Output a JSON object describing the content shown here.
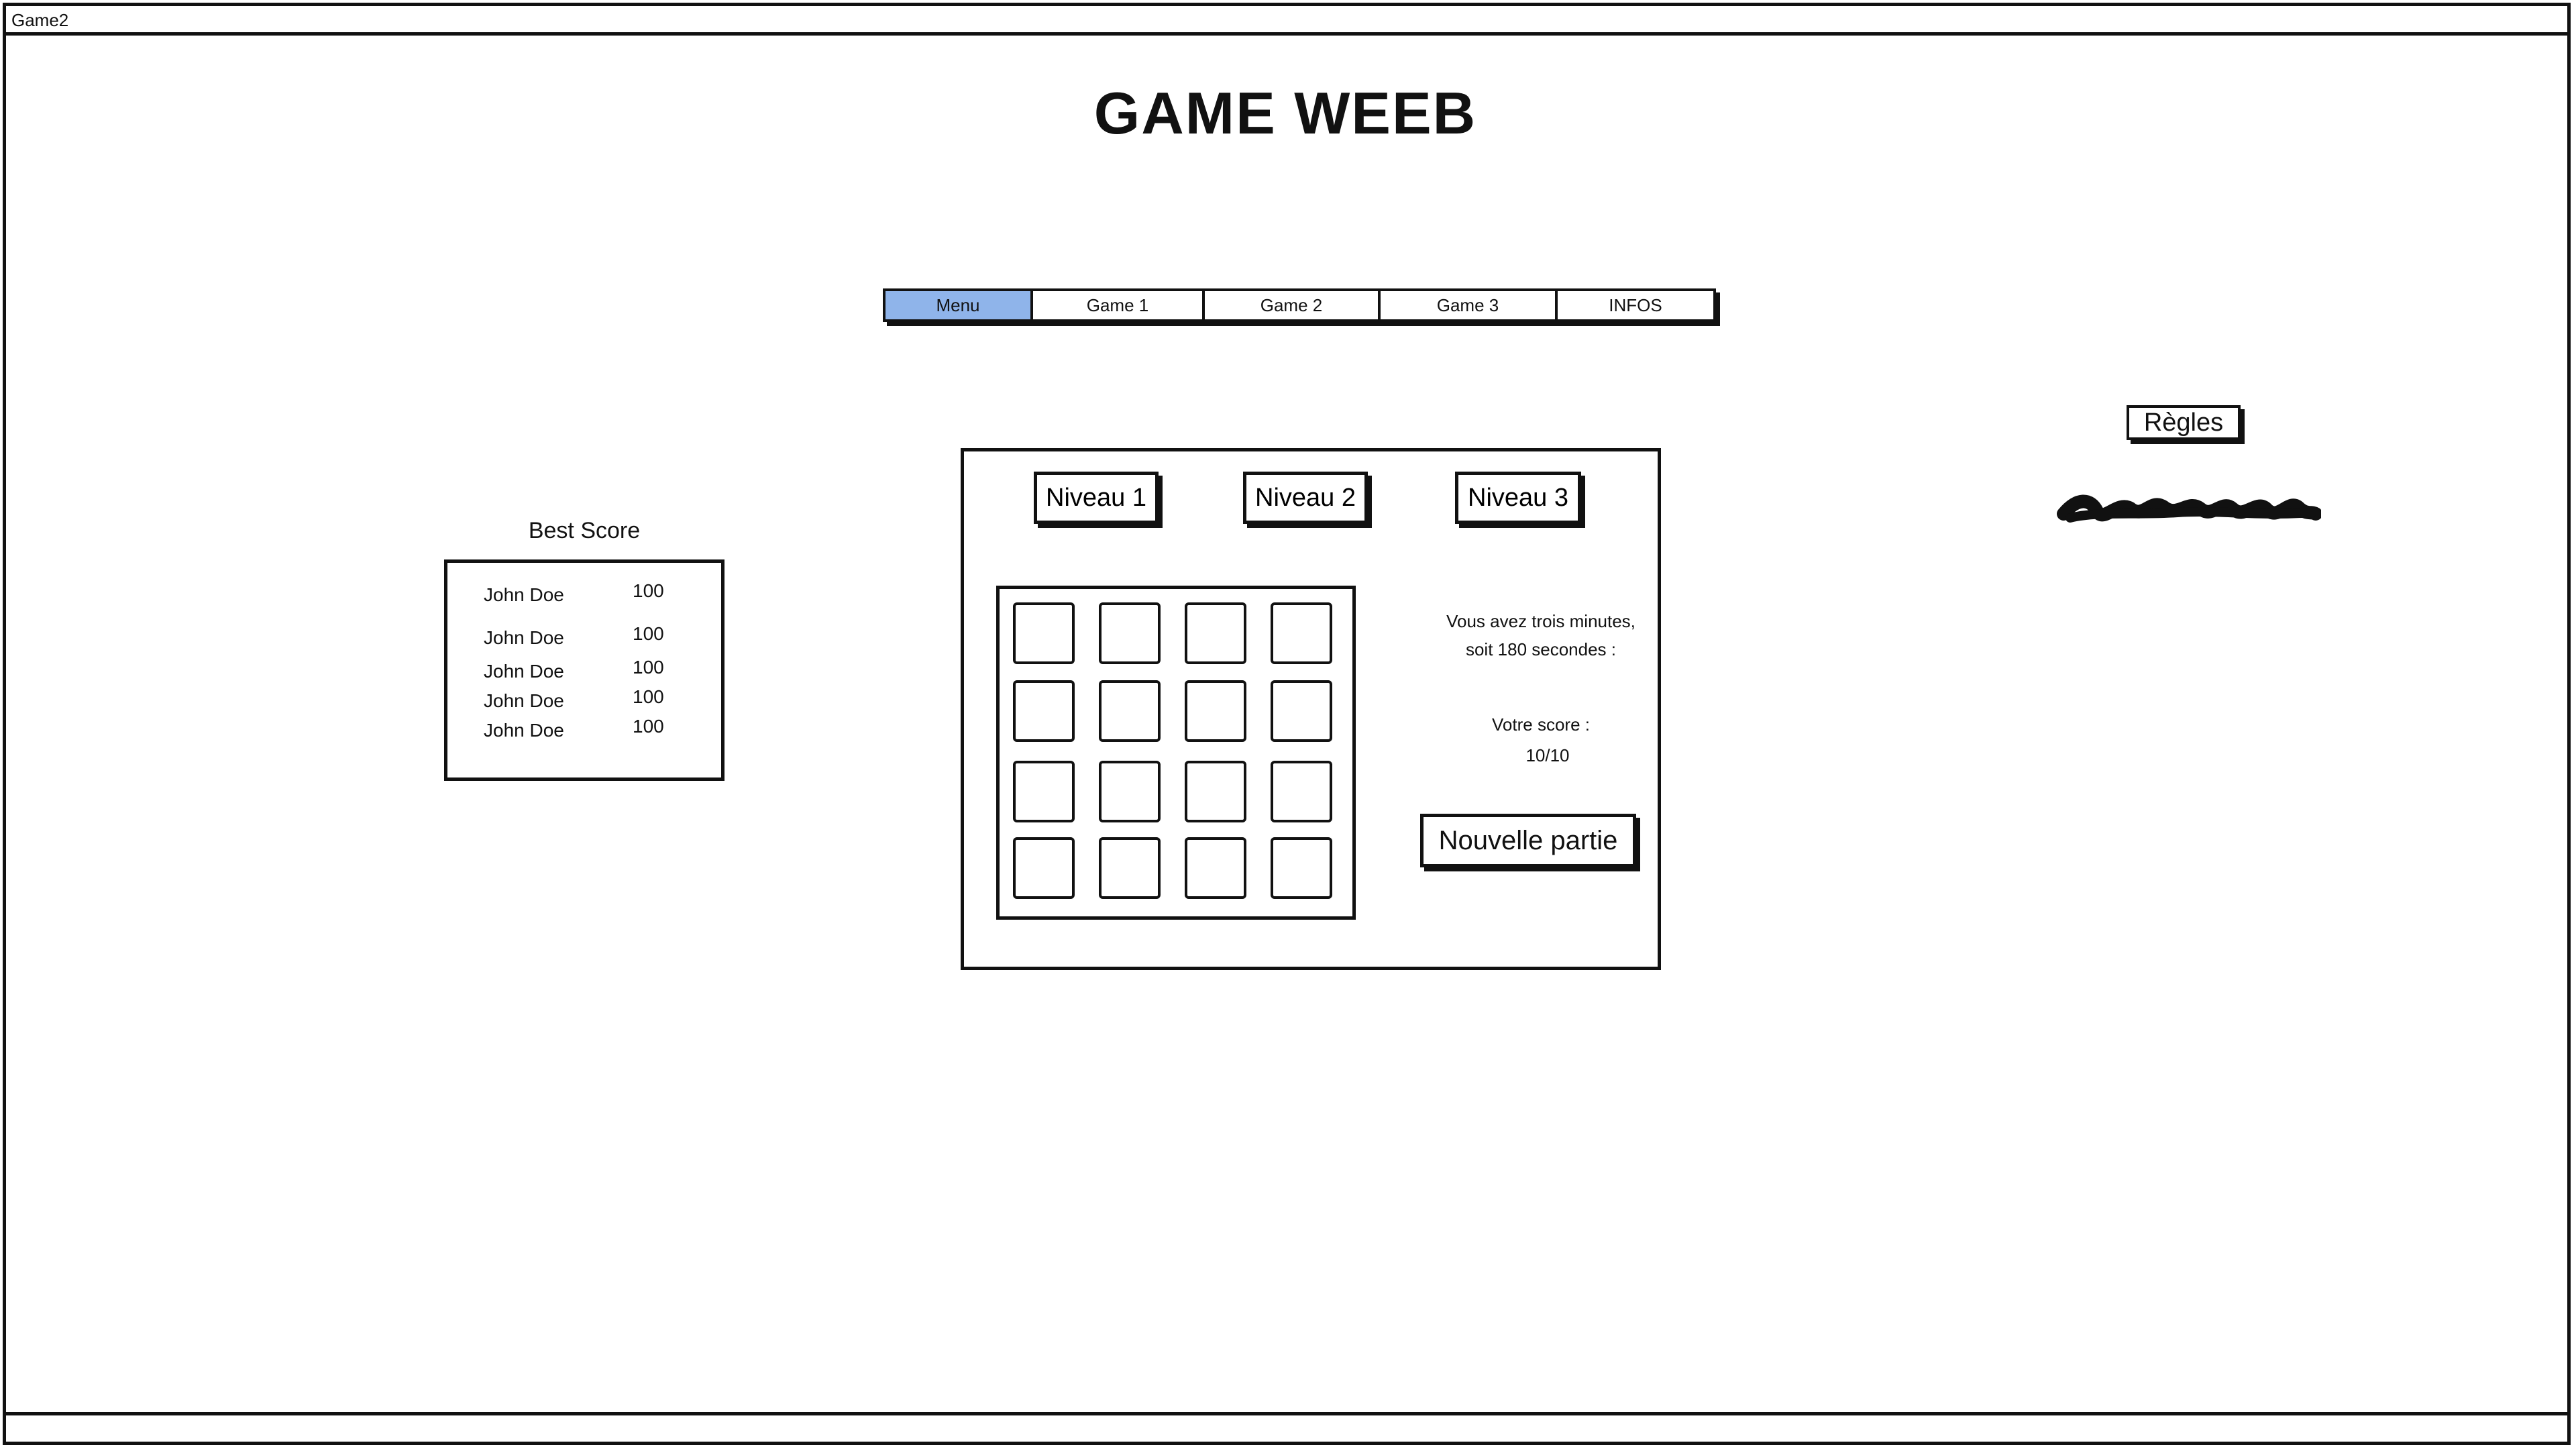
{
  "window": {
    "title": "Game2"
  },
  "header": {
    "title": "GAME WEEB"
  },
  "nav": {
    "tabs": [
      {
        "label": "Menu",
        "active": true
      },
      {
        "label": "Game 1",
        "active": false
      },
      {
        "label": "Game 2",
        "active": false
      },
      {
        "label": "Game 3",
        "active": false
      },
      {
        "label": "INFOS",
        "active": false
      }
    ],
    "active_color": "#8fb4ea"
  },
  "best_score": {
    "title": "Best Score",
    "rows": [
      {
        "name": "John Doe",
        "score": "100"
      },
      {
        "name": "John Doe",
        "score": "100"
      },
      {
        "name": "John Doe",
        "score": "100"
      },
      {
        "name": "John Doe",
        "score": "100"
      },
      {
        "name": "John Doe",
        "score": "100"
      }
    ]
  },
  "game": {
    "levels": [
      {
        "label": "Niveau 1"
      },
      {
        "label": "Niveau 2"
      },
      {
        "label": "Niveau 3"
      }
    ],
    "grid": {
      "rows": 4,
      "cols": 4
    },
    "timer_line1": "Vous avez trois minutes,",
    "timer_line2": "soit 180 secondes :",
    "score_label": "Votre score :",
    "score_value": "10/10",
    "new_game_label": "Nouvelle partie"
  },
  "rules": {
    "button_label": "Règles",
    "content_icon": "scribble-placeholder-icon"
  }
}
